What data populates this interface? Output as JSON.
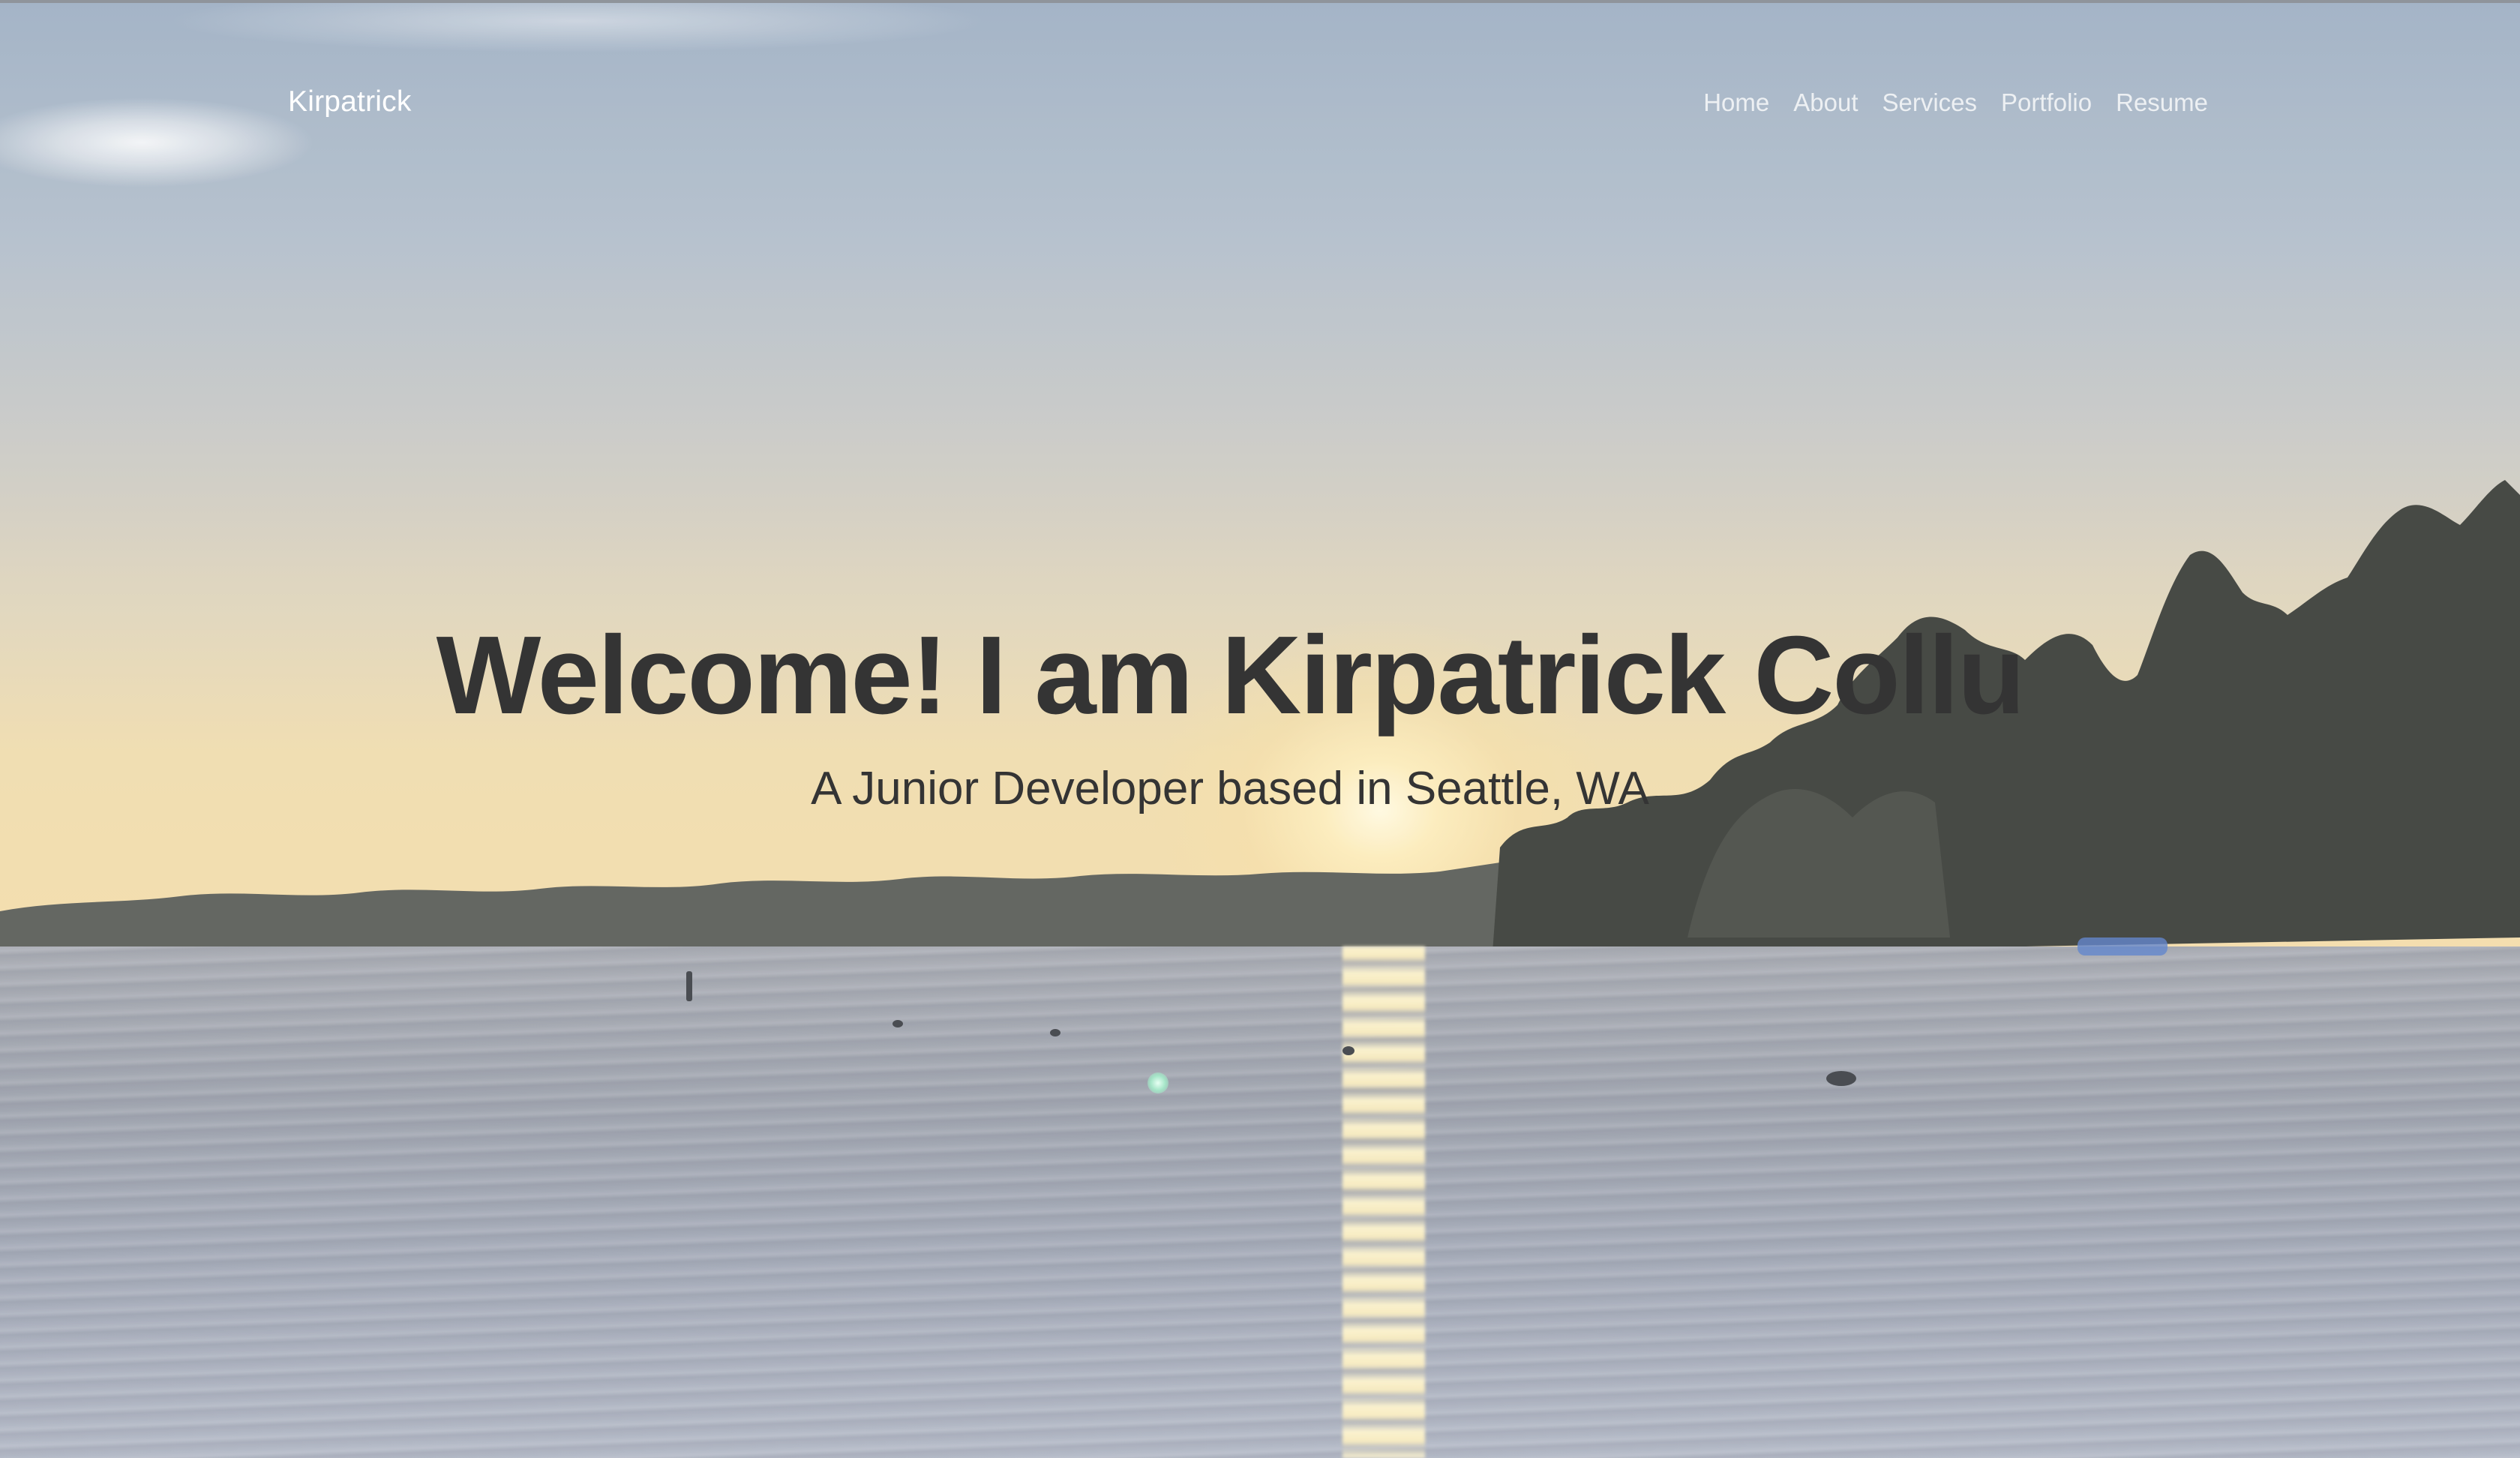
{
  "navbar": {
    "brand": "Kirpatrick",
    "links": [
      {
        "label": "Home"
      },
      {
        "label": "About"
      },
      {
        "label": "Services"
      },
      {
        "label": "Portfolio"
      },
      {
        "label": "Resume"
      }
    ]
  },
  "hero": {
    "title": "Welcome! I am Kirpatrick Collu",
    "subtitle": "A Junior Developer based in Seattle, WA"
  },
  "colors": {
    "heading_text": "#343434",
    "brand_text": "#ffffff",
    "nav_link_text": "#e6e6e6"
  }
}
